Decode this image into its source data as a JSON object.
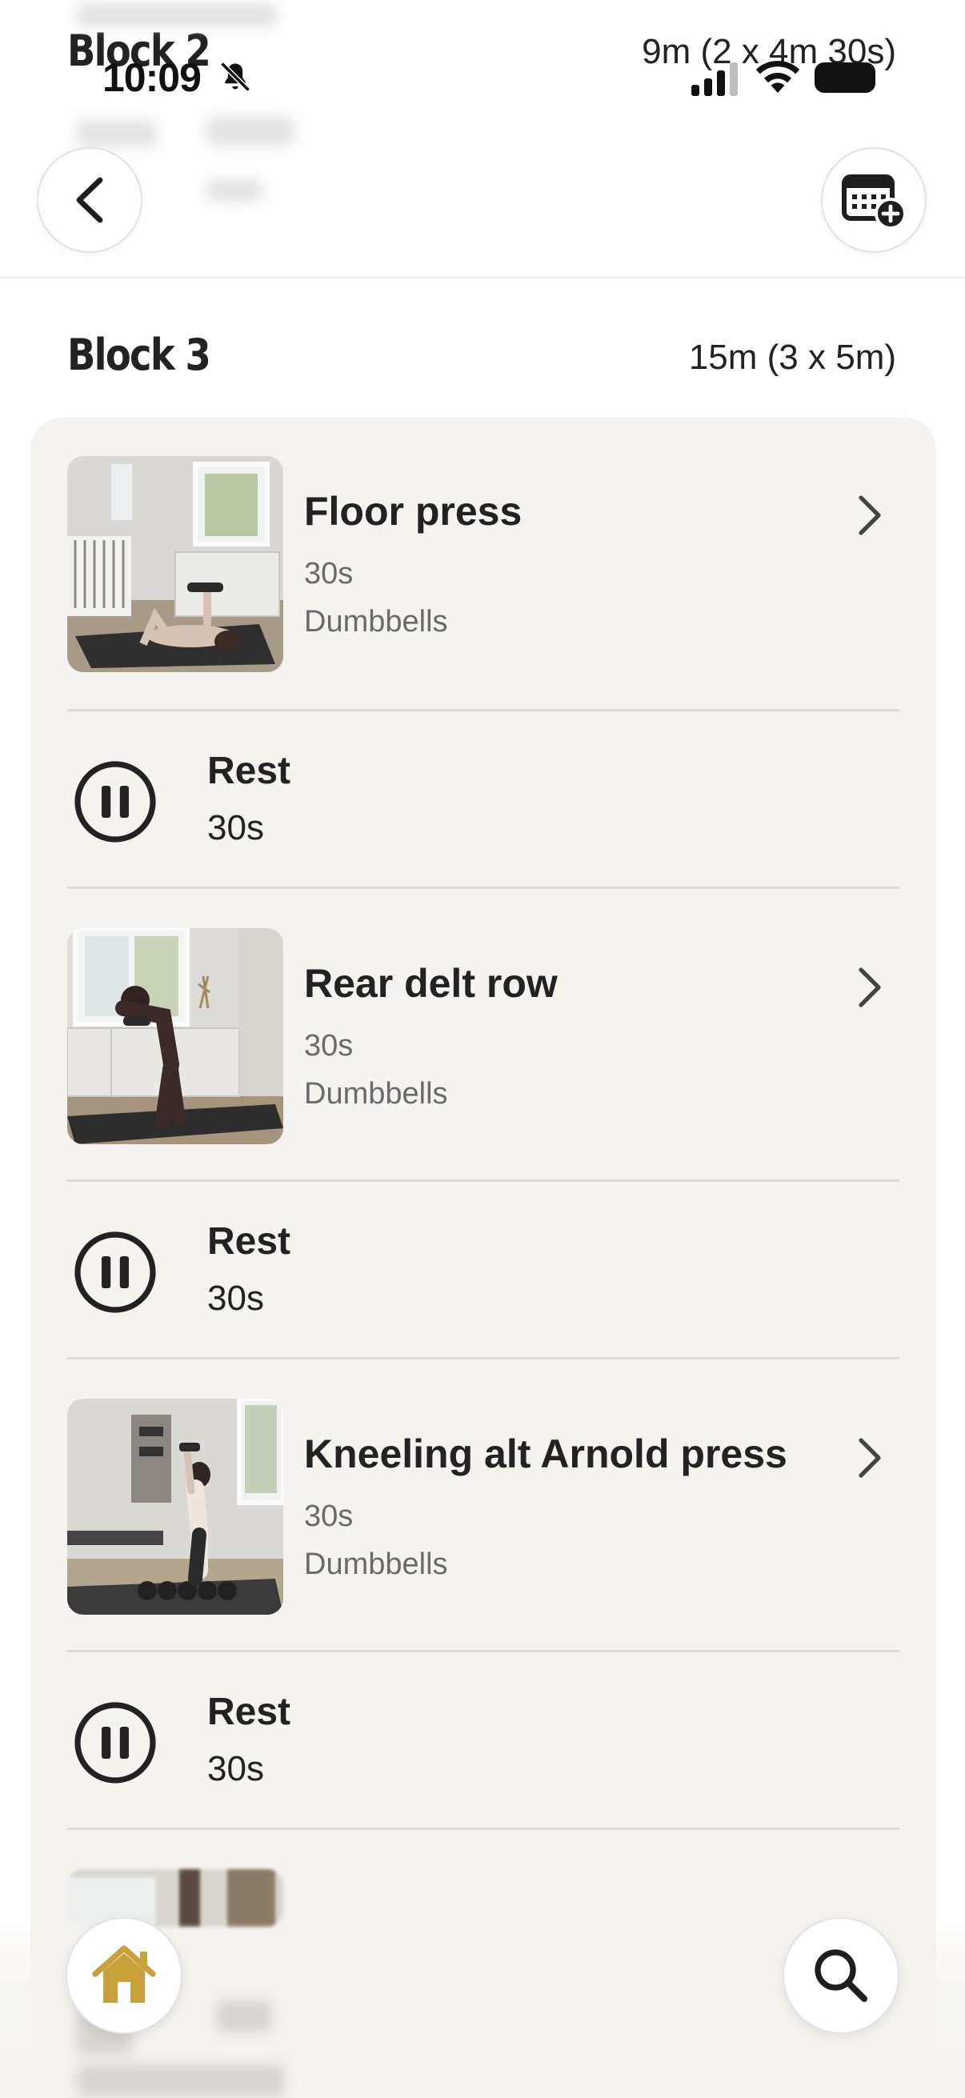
{
  "status_bar": {
    "time": "10:09"
  },
  "previous_block": {
    "title": "Block 2",
    "duration": "9m (2 x 4m 30s)"
  },
  "section": {
    "title": "Block 3",
    "duration": "15m (3 x 5m)"
  },
  "items": [
    {
      "type": "exercise",
      "name": "Floor press",
      "duration": "30s",
      "equipment": "Dumbbells"
    },
    {
      "type": "rest",
      "name": "Rest",
      "duration": "30s"
    },
    {
      "type": "exercise",
      "name": "Rear delt row",
      "duration": "30s",
      "equipment": "Dumbbells"
    },
    {
      "type": "rest",
      "name": "Rest",
      "duration": "30s"
    },
    {
      "type": "exercise",
      "name": "Kneeling alt Arnold press",
      "duration": "30s",
      "equipment": "Dumbbells"
    },
    {
      "type": "rest",
      "name": "Rest",
      "duration": "30s"
    }
  ],
  "colors": {
    "accent_home": "#c9a13b",
    "card_bg": "#f4f3f0",
    "divider": "#dedcd7"
  },
  "icons": {
    "back": "chevron-left-icon",
    "calendar": "calendar-add-icon",
    "home": "home-icon",
    "search": "search-icon",
    "rest": "pause-circle-icon",
    "row_arrow": "chevron-right-icon"
  }
}
